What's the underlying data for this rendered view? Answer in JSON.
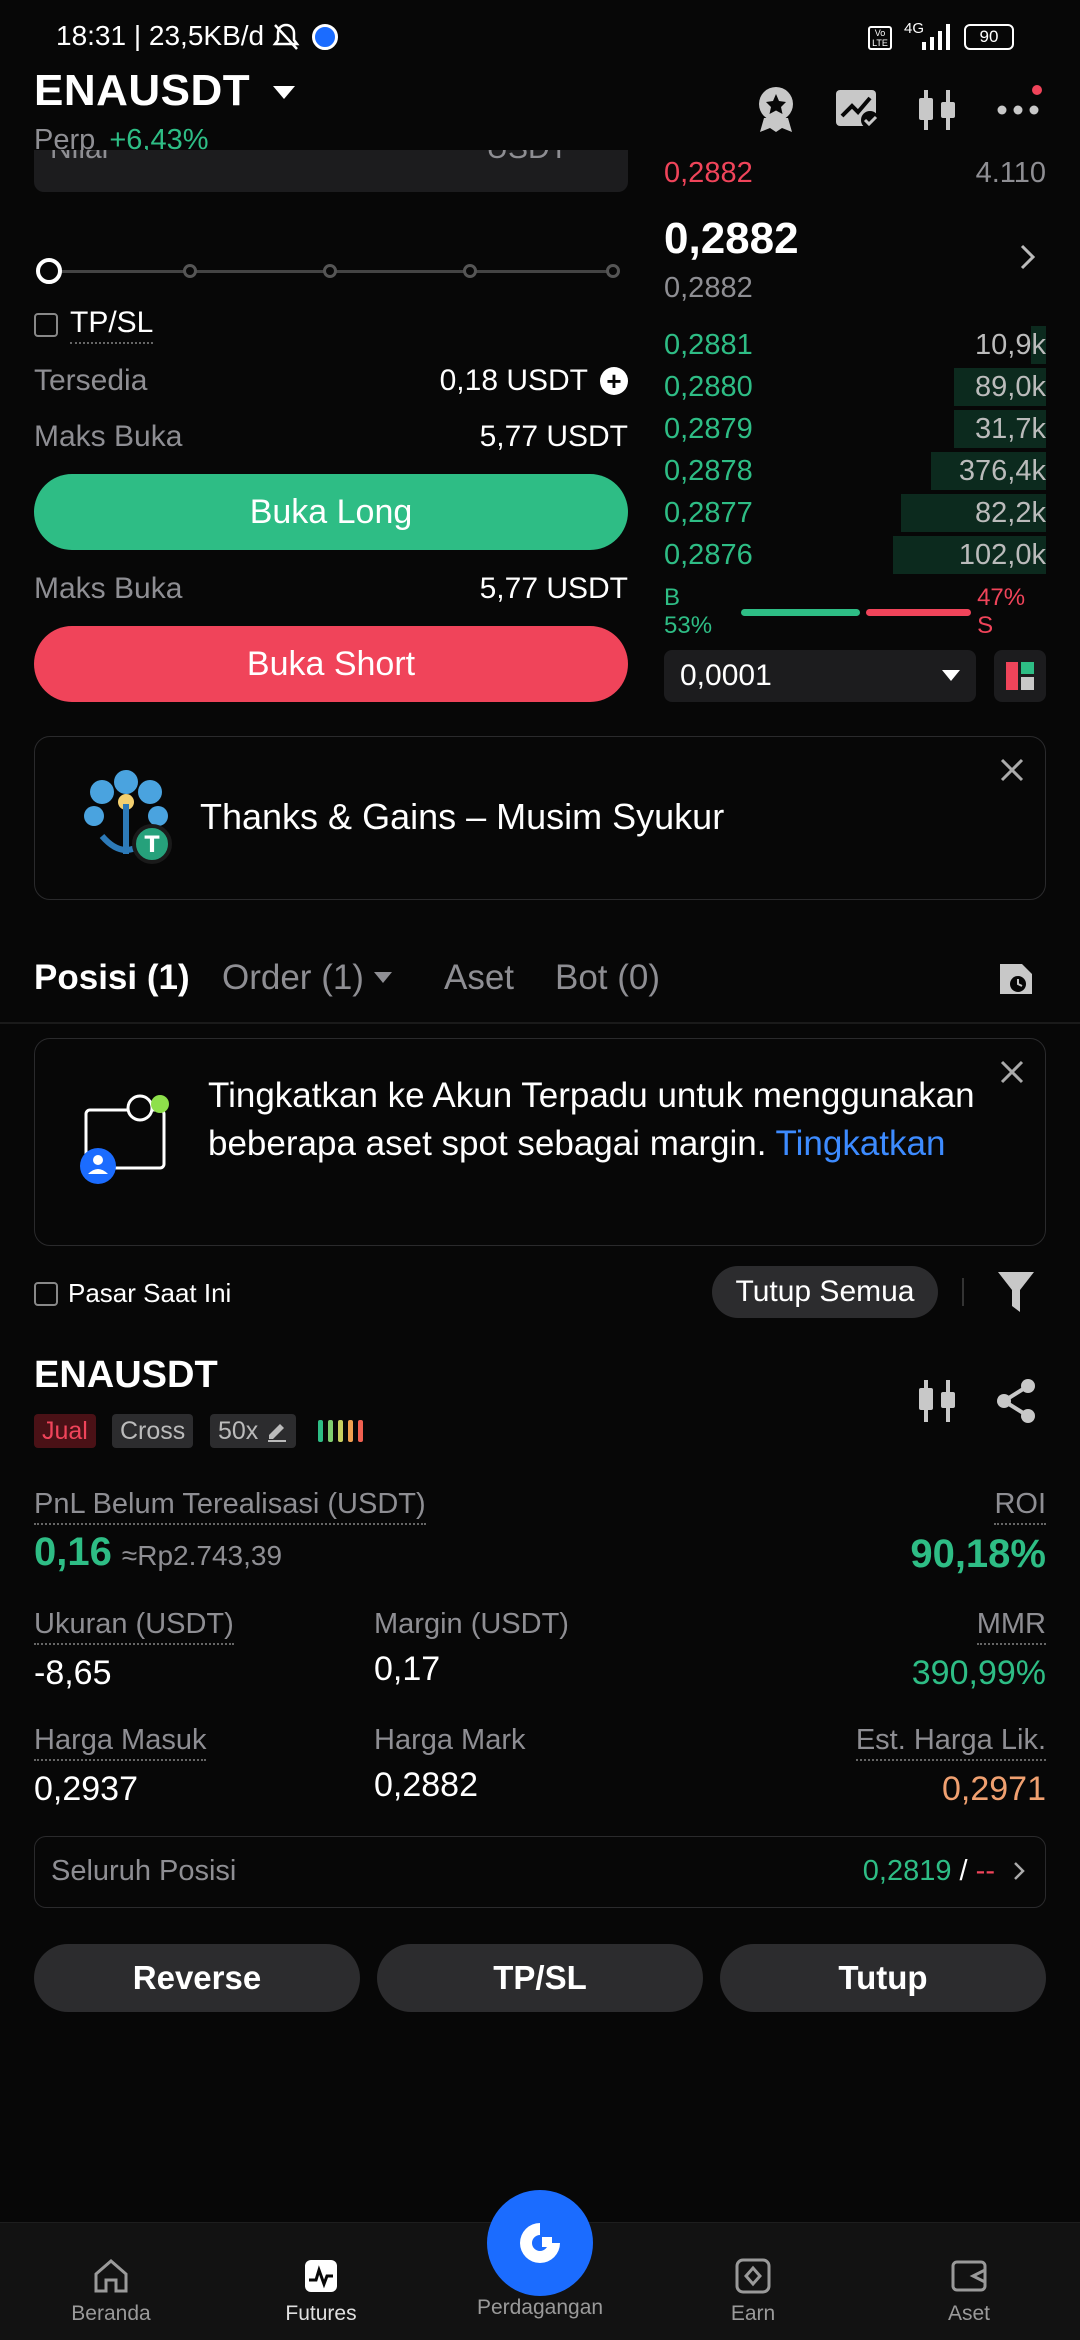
{
  "status_bar": {
    "time": "18:31 | 23,5KB/d",
    "network": "4G",
    "battery": "90"
  },
  "header": {
    "pair": "ENAUSDT",
    "contract": "Perp",
    "change": "+6,43%"
  },
  "order_form": {
    "amount_partial_left": "Nilai",
    "amount_partial_right": "USDT",
    "tpsl_label": "TP/SL",
    "available_label": "Tersedia",
    "available_value": "0,18 USDT",
    "max_open_label": "Maks Buka",
    "max_open_long": "5,77 USDT",
    "long_button": "Buka Long",
    "max_open_short": "5,77 USDT",
    "short_button": "Buka Short",
    "slider_percent": 0
  },
  "order_book": {
    "top_ask": {
      "price": "0,2882",
      "qty": "4.110"
    },
    "last_price": "0,2882",
    "mark_price": "0,2882",
    "bids": [
      {
        "price": "0,2881",
        "qty": "10,9k",
        "depth": 0.04
      },
      {
        "price": "0,2880",
        "qty": "89,0k",
        "depth": 0.24
      },
      {
        "price": "0,2879",
        "qty": "31,7k",
        "depth": 0.24
      },
      {
        "price": "0,2878",
        "qty": "376,4k",
        "depth": 0.3
      },
      {
        "price": "0,2877",
        "qty": "82,2k",
        "depth": 0.38
      },
      {
        "price": "0,2876",
        "qty": "102,0k",
        "depth": 0.4
      }
    ],
    "buy_ratio_label": "B 53%",
    "sell_ratio_label": "47% S",
    "buy_ratio": 0.53,
    "precision": "0,0001"
  },
  "promo_banner": {
    "text": "Thanks & Gains – Musim Syukur"
  },
  "tabs": [
    {
      "label": "Posisi (1)"
    },
    {
      "label": "Order (1)"
    },
    {
      "label": "Aset"
    },
    {
      "label": "Bot (0)"
    }
  ],
  "upgrade_card": {
    "text": "Tingkatkan ke Akun Terpadu untuk menggunakan beberapa aset spot sebagai margin.",
    "link": "Tingkatkan"
  },
  "filters": {
    "current_market": "Pasar Saat Ini",
    "close_all": "Tutup Semua"
  },
  "position": {
    "pair": "ENAUSDT",
    "side": "Jual",
    "margin_mode": "Cross",
    "leverage": "50x",
    "pnl_label": "PnL Belum Terealisasi (USDT)",
    "pnl_value": "0,16",
    "pnl_idr": "≈Rp2.743,39",
    "roi_label": "ROI",
    "roi_value": "90,18%",
    "size_label": "Ukuran (USDT)",
    "size_value": "-8,65",
    "margin_label": "Margin (USDT)",
    "margin_value": "0,17",
    "mmr_label": "MMR",
    "mmr_value": "390,99%",
    "entry_label": "Harga Masuk",
    "entry_value": "0,2937",
    "mark_label": "Harga Mark",
    "mark_value": "0,2882",
    "liq_label": "Est. Harga Lik.",
    "liq_value": "0,2971",
    "whole_position_label": "Seluruh Posisi",
    "tp_value": "0,2819",
    "sl_value": "--",
    "buttons": {
      "reverse": "Reverse",
      "tpsl": "TP/SL",
      "close": "Tutup"
    }
  },
  "bottom_nav": [
    {
      "label": "Beranda",
      "icon": "home-icon"
    },
    {
      "label": "Futures",
      "icon": "futures-icon"
    },
    {
      "label": "Perdagangan",
      "icon": "trade-icon"
    },
    {
      "label": "Earn",
      "icon": "earn-icon"
    },
    {
      "label": "Aset",
      "icon": "wallet-icon"
    }
  ],
  "colors": {
    "green": "#2ebd85",
    "red": "#f0445a",
    "blue": "#1b6cff",
    "orange": "#f0a070"
  }
}
